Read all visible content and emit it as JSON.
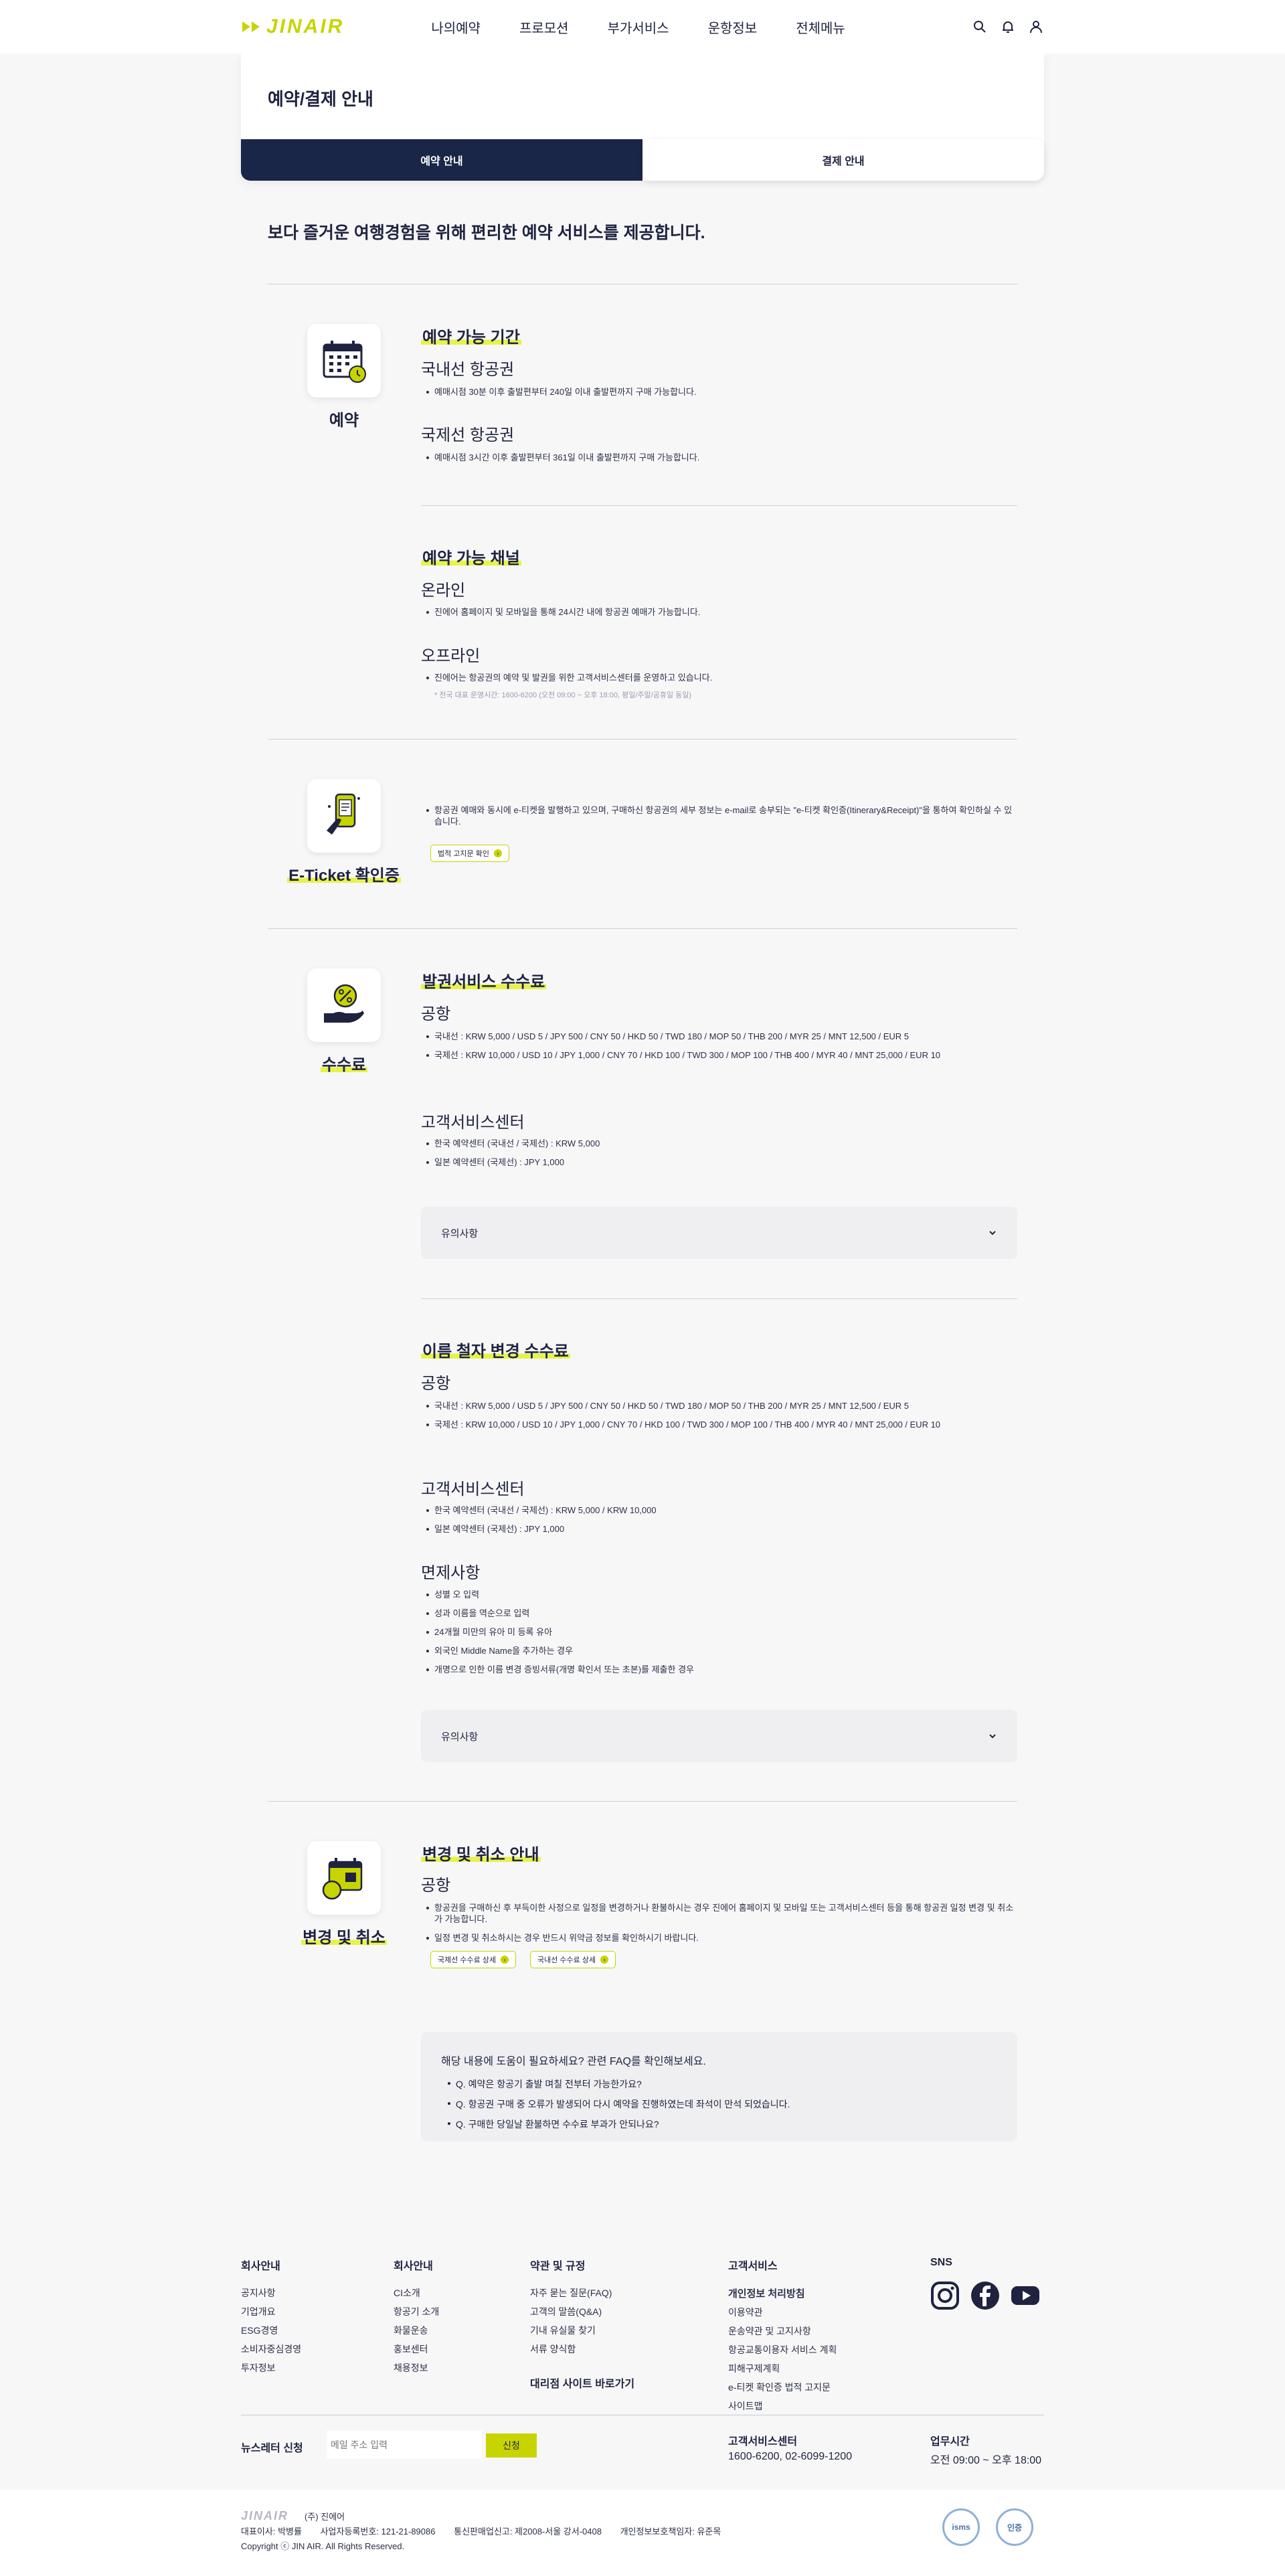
{
  "header": {
    "logo": "JINAIR",
    "nav": [
      "나의예약",
      "프로모션",
      "부가서비스",
      "운항정보",
      "전체메뉴"
    ]
  },
  "page": {
    "title": "예약/결제 안내",
    "tabs": [
      "예약 안내",
      "결제 안내"
    ],
    "lead": "보다 즐거운 여행경험을 위해 편리한 예약 서비스를 제공합니다."
  },
  "reservation": {
    "label": "예약",
    "period": {
      "title": "예약 가능 기간",
      "domestic_title": "국내선 항공권",
      "domestic_text": "예매시점 30분 이후 출발편부터 240일 이내 출발편까지 구매 가능합니다.",
      "intl_title": "국제선 항공권",
      "intl_text": "예매시점 3시간 이후 출발편부터 361일 이내 출발편까지 구매 가능합니다."
    },
    "channel": {
      "title": "예약 가능 채널",
      "online_title": "온라인",
      "online_text": "진에어 홈페이지 및 모바일을 통해 24시간 내에 항공권 예매가 가능합니다.",
      "offline_title": "오프라인",
      "offline_text": "진에어는 항공권의 예약 및 발권을 위한 고객서비스센터를 운영하고 있습니다.",
      "offline_note": "* 전국 대표 운영시간: 1600-6200 (오전 09:00 ~ 오후 18:00, 평일/주말/공휴일 동일)"
    }
  },
  "eticket": {
    "label": "E-Ticket 확인증",
    "text": "항공권 예매와 동시에 e-티켓을 발행하고 있으며, 구매하신 항공권의 세부 정보는 e-mail로 송부되는 \"e-티켓 확인증(Itinerary&Receipt)\"을 통하여 확인하실 수 있습니다.",
    "chip": "법적 고지문 확인"
  },
  "fee": {
    "label": "수수료",
    "issue": {
      "title": "발권서비스 수수료",
      "airport_title": "공항",
      "airport_items": [
        "국내선 : KRW 5,000 / USD 5 / JPY 500 / CNY 50 / HKD 50 / TWD 180 / MOP 50 / THB 200 / MYR 25 / MNT 12,500 / EUR 5",
        "국제선 : KRW 10,000 / USD 10 / JPY 1,000 / CNY 70 / HKD 100 / TWD 300 / MOP 100 / THB 400 / MYR 40 / MNT 25,000 / EUR 10"
      ],
      "cs_title": "고객서비스센터",
      "cs_items": [
        "한국 예약센터 (국내선 / 국제선) : KRW 5,000",
        "일본 예약센터 (국제선) : JPY 1,000"
      ],
      "accordion": "유의사항"
    },
    "rename": {
      "title": "이름 철자 변경 수수료",
      "airport_title": "공항",
      "airport_items": [
        "국내선 : KRW 5,000 / USD 5 / JPY 500 / CNY 50 / HKD 50 / TWD 180 / MOP 50 / THB 200 / MYR 25 / MNT 12,500 / EUR 5",
        "국제선 : KRW 10,000 / USD 10 / JPY 1,000 / CNY 70 / HKD 100 / TWD 300 / MOP 100 / THB 400 / MYR 40 / MNT 25,000 / EUR 10"
      ],
      "cs_title": "고객서비스센터",
      "cs_items": [
        "한국 예약센터 (국내선 / 국제선) : KRW 5,000 / KRW 10,000",
        "일본 예약센터 (국제선) : JPY 1,000"
      ],
      "exempt_title": "면제사항",
      "exempt_items": [
        "성별 오 입력",
        "성과 이름을 역순으로 입력",
        "24개월 미만의 유아 미 등록 유아",
        "외국인 Middle Name을 추가하는 경우",
        "개명으로 인한 이름 변경 증빙서류(개명 확인서 또는 초본)를 제출한 경우"
      ],
      "accordion": "유의사항"
    }
  },
  "change": {
    "label": "변경 및 취소",
    "title": "변경 및 취소 안내",
    "airport_title": "공항",
    "items": [
      "항공권을 구매하신 후 부득이한 사정으로 일정을 변경하거나 환불하시는 경우 진에어 홈페이지 및 모바일 또는 고객서비스센터 등을 통해 항공권 일정 변경 및 취소가 가능합니다.",
      "일정 변경 및 취소하시는 경우 반드시 위약금 정보를 확인하시기 바랍니다."
    ],
    "chips": [
      "국제선 수수료 상세",
      "국내선 수수료 상세"
    ]
  },
  "faq": {
    "lead": "해당 내용에 도움이 필요하세요? 관련 FAQ를 확인해보세요.",
    "items": [
      "Q. 예약은 항공기 출발 며칠 전부터 가능한가요?",
      "Q. 항공권 구매 중 오류가 발생되어 다시 예약을 진행하였는데 좌석이 만석 되었습니다.",
      "Q. 구매한 당일날 환불하면 수수료 부과가 안되나요?"
    ]
  },
  "footer": {
    "company": {
      "title": "회사안내",
      "links": [
        "공지사항",
        "기업개요",
        "ESG경영",
        "소비자중심경영",
        "투자정보"
      ]
    },
    "company2": {
      "title": "회사안내",
      "links": [
        "CI소개",
        "항공기 소개",
        "화물운송",
        "홍보센터",
        "채용정보"
      ]
    },
    "terms": {
      "title": "약관 및 규정",
      "links": [
        "자주 묻는 질문(FAQ)",
        "고객의 말씀(Q&A)",
        "기내 유실물 찾기",
        "서류 양식함"
      ],
      "agency": "대리점 사이트 바로가기"
    },
    "customer": {
      "title": "고객서비스",
      "privacy": "개인정보 처리방침",
      "links": [
        "이용약관",
        "운송약관 및 고지사항",
        "항공교통이용자 서비스 계획",
        "피해구제계획",
        "e-티켓 확인증 법적 고지문",
        "사이트맵"
      ]
    },
    "sns": {
      "title": "SNS"
    },
    "newsletter": {
      "label": "뉴스레터 신청",
      "placeholder": "메일 주소 입력",
      "button": "신청"
    },
    "cs": {
      "title": "고객서비스센터",
      "phone": "1600-6200, 02-6099-1200"
    },
    "hours": {
      "title": "업무시간",
      "value": "오전 09:00 ~ 오후 18:00"
    },
    "bottom": {
      "logo": "JINAIR",
      "corp": "(주) 진에어",
      "ceo": "대표이사: 박병률",
      "bizno": "사업자등록번호: 121-21-89086",
      "mailorder": "통신판매업신고: 제2008-서울 강서-0408",
      "privacy_officer": "개인정보보호책임자: 유준목",
      "copyright": "Copyright ⓒ JIN AIR. All Rights Reserved.",
      "cert1": "isms",
      "cert2": "인증"
    }
  },
  "colors": {
    "brand": "#c8d400",
    "navy": "#1a2647"
  }
}
